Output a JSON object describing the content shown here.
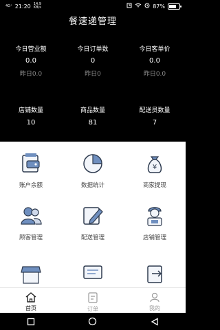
{
  "status_bar": {
    "time": "21:20",
    "network_left": "4G⁺",
    "speed_top": "14.9",
    "speed_unit": "KB/s",
    "battery": "87%",
    "battery_level": 0.87
  },
  "title": "餐速递管理",
  "stats_top": [
    {
      "label": "今日营业额",
      "value": "0.0",
      "sub": "昨日0.0"
    },
    {
      "label": "今日订单数",
      "value": "0",
      "sub": "昨日0"
    },
    {
      "label": "今日客单价",
      "value": "0.0",
      "sub": "昨日0.0"
    }
  ],
  "stats_bottom": [
    {
      "label": "店铺数量",
      "value": "10"
    },
    {
      "label": "商品数量",
      "value": "81"
    },
    {
      "label": "配送员数量",
      "value": "7"
    }
  ],
  "grid": [
    {
      "label": "账户余额",
      "icon": "wallet-icon"
    },
    {
      "label": "数据统计",
      "icon": "pie-chart-icon"
    },
    {
      "label": "商家提现",
      "icon": "money-bag-icon"
    },
    {
      "label": "顾客管理",
      "icon": "users-icon"
    },
    {
      "label": "配送管理",
      "icon": "edit-icon"
    },
    {
      "label": "店铺管理",
      "icon": "delivery-person-icon"
    },
    {
      "label": "",
      "icon": "store-icon"
    },
    {
      "label": "",
      "icon": "message-icon"
    },
    {
      "label": "",
      "icon": "logout-icon"
    }
  ],
  "tabs": [
    {
      "label": "首页",
      "icon": "home-icon",
      "active": true
    },
    {
      "label": "订单",
      "icon": "order-icon",
      "active": false
    },
    {
      "label": "我的",
      "icon": "profile-icon",
      "active": false
    }
  ],
  "colors": {
    "header_bg": "#000000",
    "grid_icon_blue": "#6f8fbf",
    "grid_icon_dark": "#2e3b4f",
    "muted": "#8d8d8d"
  }
}
